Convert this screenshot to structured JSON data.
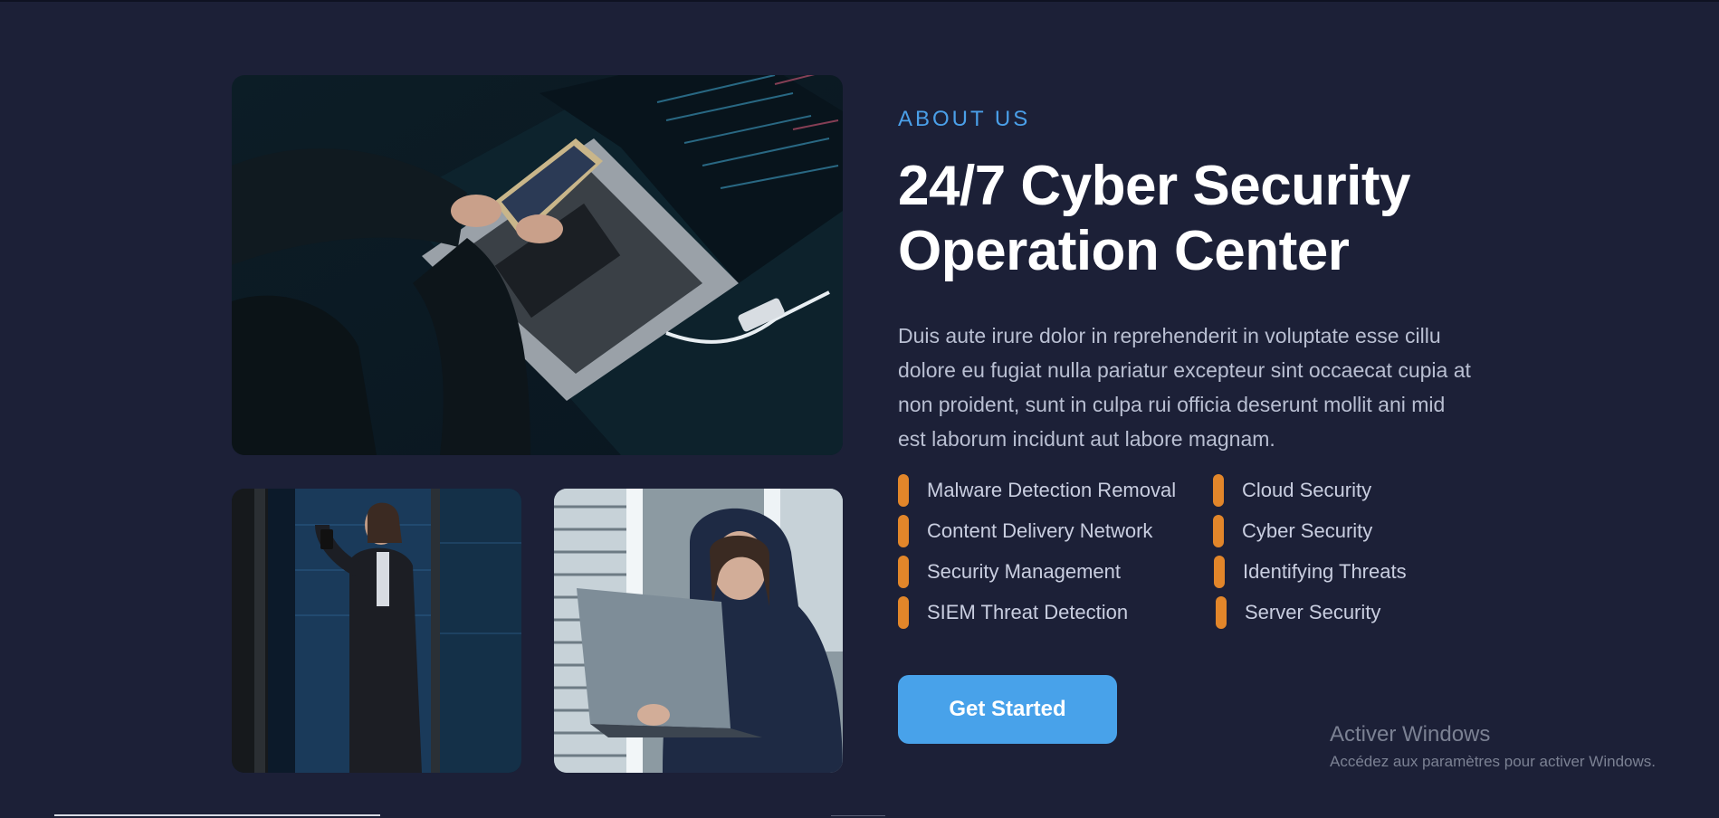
{
  "about": {
    "eyebrow": "ABOUT US",
    "heading_line1": "24/7 Cyber Security",
    "heading_line2": "Operation Center",
    "paragraph": "Duis aute irure dolor in reprehenderit in voluptate esse cillu dolore eu fugiat nulla pariatur excepteur sint occaecat cupia at non proident, sunt in culpa rui officia deserunt mollit ani mid est laborum incidunt aut labore magnam."
  },
  "features": {
    "left": [
      "Malware Detection Removal",
      "Content Delivery Network",
      "Security Management",
      "SIEM Threat Detection"
    ],
    "right": [
      "Cloud Security",
      "Cyber Security",
      "Identifying Threats",
      "Server Security"
    ]
  },
  "cta": {
    "label": "Get Started"
  },
  "watermark": {
    "title": "Activer Windows",
    "subtitle": "Accédez aux paramètres pour activer Windows."
  },
  "colors": {
    "background": "#1c2037",
    "accent": "#4a9fe8",
    "bullet": "#e2862a",
    "button": "#48a2ea"
  },
  "images": {
    "main": "hacker-laptop-phone-photo",
    "left": "server-room-woman-photo",
    "right": "hooded-woman-laptop-photo"
  }
}
